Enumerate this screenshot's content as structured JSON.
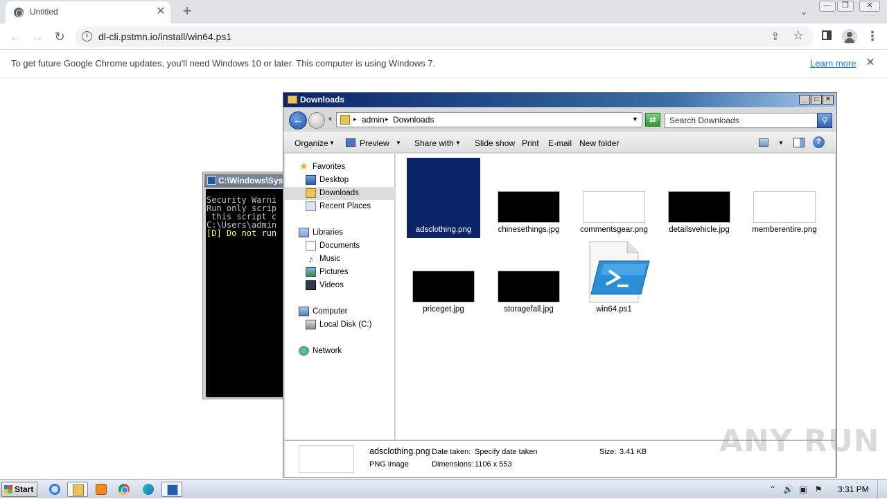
{
  "browser": {
    "tab_title": "Untitled",
    "tab_close": "✕",
    "new_tab": "+",
    "tab_search": "⌄",
    "window_buttons": [
      "—",
      "❐",
      "✕"
    ],
    "back": "←",
    "forward": "→",
    "reload": "↻",
    "url": "dl-cli.pstmn.io/install/win64.ps1",
    "info_icon": "i",
    "share_icon": "⇪",
    "star_icon": "☆",
    "menu_icon": "⋮"
  },
  "infobar": {
    "message": "To get future Google Chrome updates, you'll need Windows 10 or later. This computer is using Windows 7.",
    "learn_more": "Learn more",
    "close": "✕"
  },
  "console": {
    "title": "C:\\Windows\\Sys",
    "lines": [
      "Security Warni",
      "Run only scrip",
      " this script c",
      "C:\\Users\\admin",
      "[D] Do not run"
    ]
  },
  "explorer": {
    "title": "Downloads",
    "title_buttons": [
      "_",
      "□",
      "✕"
    ],
    "breadcrumb": [
      "admin",
      "Downloads"
    ],
    "search_placeholder": "Search Downloads",
    "commands": [
      "Organize",
      "Preview",
      "Share with",
      "Slide show",
      "Print",
      "E-mail",
      "New folder"
    ],
    "nav": {
      "favorites": "Favorites",
      "desktop": "Desktop",
      "downloads": "Downloads",
      "recent": "Recent Places",
      "libraries": "Libraries",
      "documents": "Documents",
      "music": "Music",
      "pictures": "Pictures",
      "videos": "Videos",
      "computer": "Computer",
      "local_disk": "Local Disk (C:)",
      "network": "Network"
    },
    "files": [
      {
        "name": "adsclothing.png",
        "thumb": "dark",
        "selected": true
      },
      {
        "name": "chinesethings.jpg",
        "thumb": "dark"
      },
      {
        "name": "commentsgear.png",
        "thumb": "white"
      },
      {
        "name": "detailsvehicle.jpg",
        "thumb": "dark"
      },
      {
        "name": "memberentire.png",
        "thumb": "white"
      },
      {
        "name": "priceget.jpg",
        "thumb": "dark"
      },
      {
        "name": "storagefall.jpg",
        "thumb": "dark"
      },
      {
        "name": "win64.ps1",
        "thumb": "script"
      }
    ],
    "details": {
      "name": "adsclothing.png",
      "type": "PNG image",
      "date_label": "Date taken:",
      "date_value": "Specify date taken",
      "dim_label": "Dimensions:",
      "dim_value": "1106 x 553",
      "size_label": "Size:",
      "size_value": "3.41 KB"
    }
  },
  "watermark": "ANY RUN",
  "taskbar": {
    "start": "Start",
    "clock": "3:31 PM",
    "tray": [
      "⌃",
      "🔊",
      "▣",
      "⚑"
    ]
  }
}
